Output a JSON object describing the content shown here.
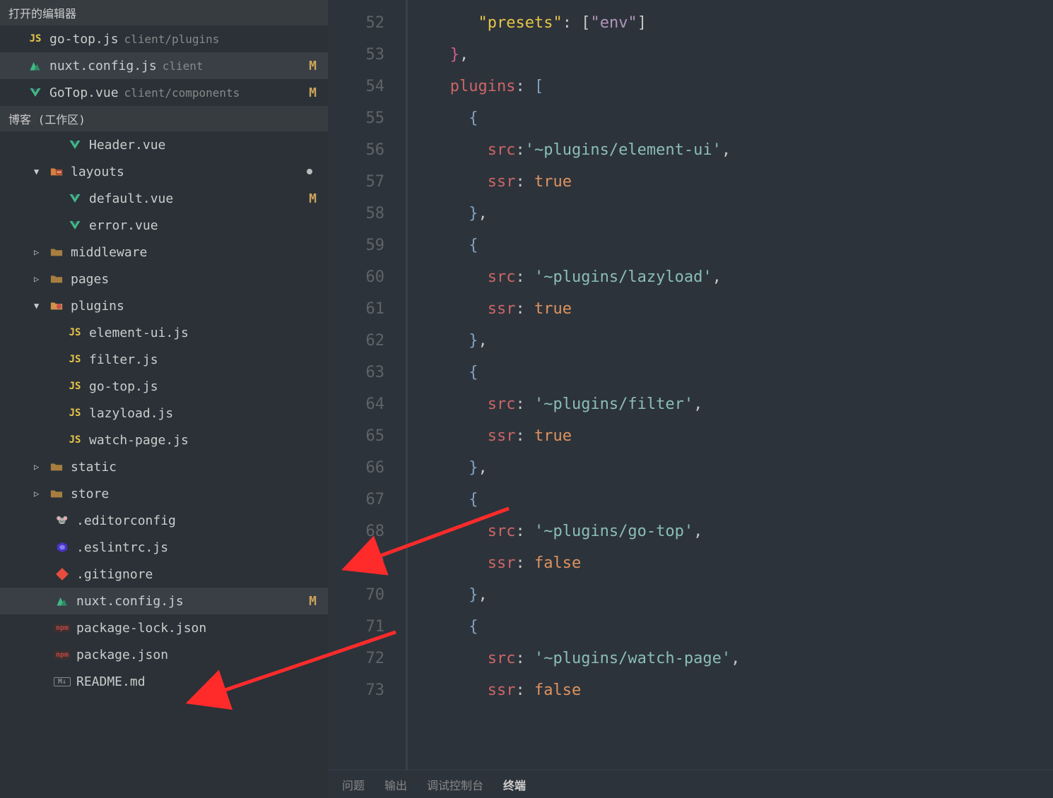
{
  "openEditors": {
    "title": "打开的编辑器",
    "items": [
      {
        "icon": "js",
        "name": "go-top.js",
        "path": "client/plugins",
        "badge": ""
      },
      {
        "icon": "nuxt",
        "name": "nuxt.config.js",
        "path": "client",
        "badge": "M",
        "selected": true
      },
      {
        "icon": "vue",
        "name": "GoTop.vue",
        "path": "client/components",
        "badge": "M"
      }
    ]
  },
  "workspace": {
    "title": "博客 (工作区)",
    "tree": [
      {
        "indent": 3,
        "icon": "vue",
        "name": "Header.vue"
      },
      {
        "indent": 1,
        "arrow": "down",
        "icon": "folder-src",
        "name": "layouts",
        "badgeDot": true
      },
      {
        "indent": 3,
        "icon": "vue",
        "name": "default.vue",
        "badge": "M"
      },
      {
        "indent": 3,
        "icon": "vue",
        "name": "error.vue"
      },
      {
        "indent": 1,
        "arrow": "right",
        "icon": "folder",
        "name": "middleware"
      },
      {
        "indent": 1,
        "arrow": "right",
        "icon": "folder",
        "name": "pages"
      },
      {
        "indent": 1,
        "arrow": "down",
        "icon": "folder-plugins",
        "name": "plugins"
      },
      {
        "indent": 3,
        "icon": "js",
        "name": "element-ui.js"
      },
      {
        "indent": 3,
        "icon": "js",
        "name": "filter.js"
      },
      {
        "indent": 3,
        "icon": "js",
        "name": "go-top.js"
      },
      {
        "indent": 3,
        "icon": "js",
        "name": "lazyload.js"
      },
      {
        "indent": 3,
        "icon": "js",
        "name": "watch-page.js"
      },
      {
        "indent": 1,
        "arrow": "right",
        "icon": "folder",
        "name": "static"
      },
      {
        "indent": 1,
        "arrow": "right",
        "icon": "folder",
        "name": "store"
      },
      {
        "indent": 2,
        "icon": "editorconfig",
        "name": ".editorconfig"
      },
      {
        "indent": 2,
        "icon": "eslint",
        "name": ".eslintrc.js"
      },
      {
        "indent": 2,
        "icon": "git",
        "name": ".gitignore"
      },
      {
        "indent": 2,
        "icon": "nuxt",
        "name": "nuxt.config.js",
        "badge": "M",
        "selected": true
      },
      {
        "indent": 2,
        "icon": "npm",
        "name": "package-lock.json"
      },
      {
        "indent": 2,
        "icon": "npm",
        "name": "package.json"
      },
      {
        "indent": 2,
        "icon": "md",
        "name": "README.md"
      }
    ]
  },
  "code": {
    "startLine": 52,
    "lines": [
      [
        {
          "t": "      ",
          "c": "punct"
        },
        {
          "t": "\"presets\"",
          "c": "key"
        },
        {
          "t": ": [",
          "c": "punct"
        },
        {
          "t": "\"env\"",
          "c": "str-quote"
        },
        {
          "t": "]",
          "c": "punct"
        }
      ],
      [
        {
          "t": "   ",
          "c": "punct"
        },
        {
          "t": "}",
          "c": "magenta"
        },
        {
          "t": ",",
          "c": "punct"
        }
      ],
      [
        {
          "t": "   ",
          "c": "punct"
        },
        {
          "t": "plugins",
          "c": "plugins"
        },
        {
          "t": ": ",
          "c": "punct"
        },
        {
          "t": "[",
          "c": "bracket"
        }
      ],
      [
        {
          "t": "     ",
          "c": "punct"
        },
        {
          "t": "{",
          "c": "brace"
        }
      ],
      [
        {
          "t": "       ",
          "c": "punct"
        },
        {
          "t": "src",
          "c": "key-red"
        },
        {
          "t": ":",
          "c": "punct"
        },
        {
          "t": "'~plugins/element-ui'",
          "c": "str"
        },
        {
          "t": ",",
          "c": "punct"
        }
      ],
      [
        {
          "t": "       ",
          "c": "punct"
        },
        {
          "t": "ssr",
          "c": "key-red"
        },
        {
          "t": ": ",
          "c": "punct"
        },
        {
          "t": "true",
          "c": "bool"
        }
      ],
      [
        {
          "t": "     ",
          "c": "punct"
        },
        {
          "t": "}",
          "c": "brace"
        },
        {
          "t": ",",
          "c": "punct"
        }
      ],
      [
        {
          "t": "     ",
          "c": "punct"
        },
        {
          "t": "{",
          "c": "brace"
        }
      ],
      [
        {
          "t": "       ",
          "c": "punct"
        },
        {
          "t": "src",
          "c": "key-red"
        },
        {
          "t": ": ",
          "c": "punct"
        },
        {
          "t": "'~plugins/lazyload'",
          "c": "str"
        },
        {
          "t": ",",
          "c": "punct"
        }
      ],
      [
        {
          "t": "       ",
          "c": "punct"
        },
        {
          "t": "ssr",
          "c": "key-red"
        },
        {
          "t": ": ",
          "c": "punct"
        },
        {
          "t": "true",
          "c": "bool"
        }
      ],
      [
        {
          "t": "     ",
          "c": "punct"
        },
        {
          "t": "}",
          "c": "brace"
        },
        {
          "t": ",",
          "c": "punct"
        }
      ],
      [
        {
          "t": "     ",
          "c": "punct"
        },
        {
          "t": "{",
          "c": "brace"
        }
      ],
      [
        {
          "t": "       ",
          "c": "punct"
        },
        {
          "t": "src",
          "c": "key-red"
        },
        {
          "t": ": ",
          "c": "punct"
        },
        {
          "t": "'~plugins/filter'",
          "c": "str"
        },
        {
          "t": ",",
          "c": "punct"
        }
      ],
      [
        {
          "t": "       ",
          "c": "punct"
        },
        {
          "t": "ssr",
          "c": "key-red"
        },
        {
          "t": ": ",
          "c": "punct"
        },
        {
          "t": "true",
          "c": "bool"
        }
      ],
      [
        {
          "t": "     ",
          "c": "punct"
        },
        {
          "t": "}",
          "c": "brace"
        },
        {
          "t": ",",
          "c": "punct"
        }
      ],
      [
        {
          "t": "     ",
          "c": "punct"
        },
        {
          "t": "{",
          "c": "brace"
        }
      ],
      [
        {
          "t": "       ",
          "c": "punct"
        },
        {
          "t": "src",
          "c": "key-red"
        },
        {
          "t": ": ",
          "c": "punct"
        },
        {
          "t": "'~plugins/go-top'",
          "c": "str"
        },
        {
          "t": ",",
          "c": "punct"
        }
      ],
      [
        {
          "t": "       ",
          "c": "punct"
        },
        {
          "t": "ssr",
          "c": "key-red"
        },
        {
          "t": ": ",
          "c": "punct"
        },
        {
          "t": "false",
          "c": "bool"
        }
      ],
      [
        {
          "t": "     ",
          "c": "punct"
        },
        {
          "t": "}",
          "c": "brace"
        },
        {
          "t": ",",
          "c": "punct"
        }
      ],
      [
        {
          "t": "     ",
          "c": "punct"
        },
        {
          "t": "{",
          "c": "brace"
        }
      ],
      [
        {
          "t": "       ",
          "c": "punct"
        },
        {
          "t": "src",
          "c": "key-red"
        },
        {
          "t": ": ",
          "c": "punct"
        },
        {
          "t": "'~plugins/watch-page'",
          "c": "str"
        },
        {
          "t": ",",
          "c": "punct"
        }
      ],
      [
        {
          "t": "       ",
          "c": "punct"
        },
        {
          "t": "ssr",
          "c": "key-red"
        },
        {
          "t": ": ",
          "c": "punct"
        },
        {
          "t": "false",
          "c": "bool"
        }
      ]
    ]
  },
  "panelTabs": {
    "items": [
      "问题",
      "输出",
      "调试控制台",
      "终端"
    ],
    "active": 3
  }
}
